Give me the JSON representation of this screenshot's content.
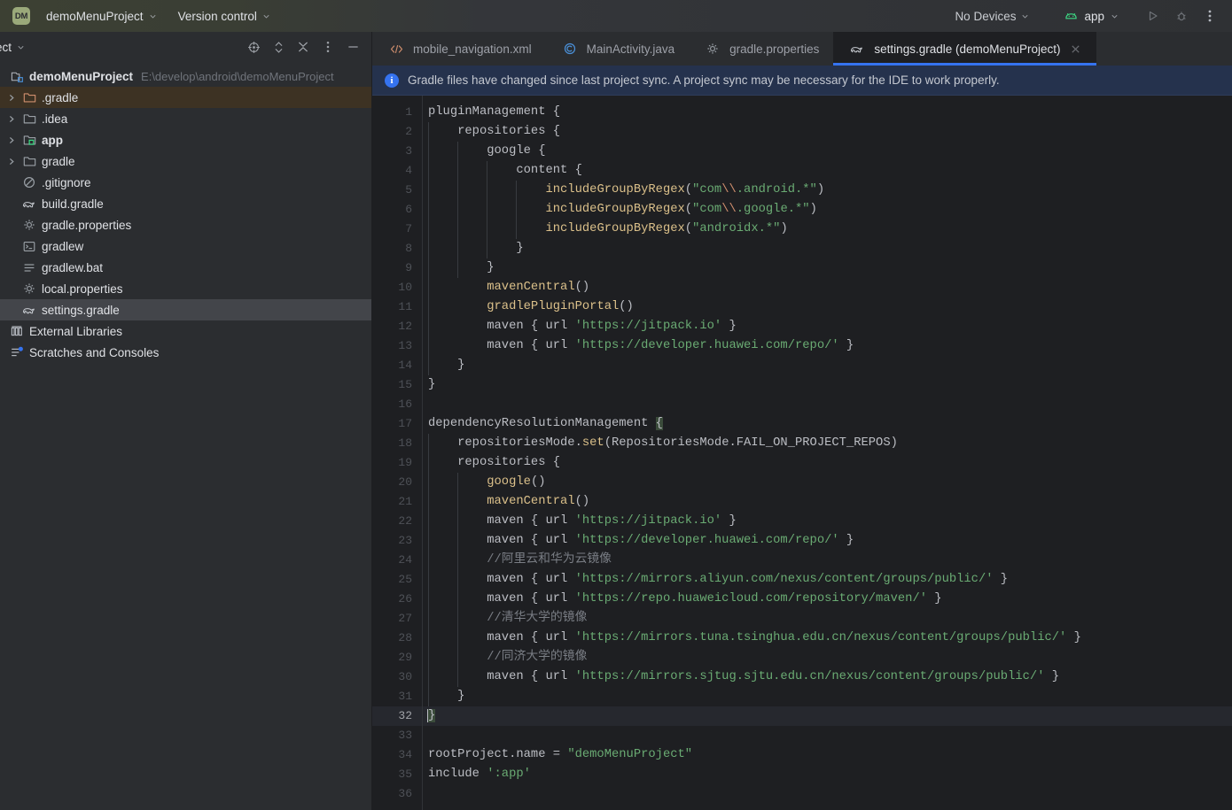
{
  "titlebar": {
    "project_badge": "DM",
    "project_name": "demoMenuProject",
    "version_control": "Version control",
    "devices": "No Devices",
    "run_config": "app",
    "run_tooltip": "Run",
    "debug_tooltip": "Debug",
    "more_tooltip": "More Actions",
    "accent_badge_color": "#9aa97a"
  },
  "sidebar": {
    "title": "ject",
    "tools": [
      "select-opened-file-icon",
      "expand-collapse-icon",
      "collapse-all-icon",
      "options-icon",
      "hide-icon"
    ],
    "tree": [
      {
        "label": "demoMenuProject",
        "path": "E:\\develop\\android\\demoMenuProject",
        "icon": "project-icon",
        "arrow": false,
        "bold": true,
        "state": "root"
      },
      {
        "label": ".gradle",
        "path": "",
        "icon": "folder-orange-icon",
        "arrow": true,
        "bold": false,
        "state": "highlighted"
      },
      {
        "label": ".idea",
        "path": "",
        "icon": "folder-icon",
        "arrow": true,
        "bold": false,
        "state": "normal"
      },
      {
        "label": "app",
        "path": "",
        "icon": "module-icon",
        "arrow": true,
        "bold": true,
        "state": "normal"
      },
      {
        "label": "gradle",
        "path": "",
        "icon": "folder-icon",
        "arrow": true,
        "bold": false,
        "state": "normal"
      },
      {
        "label": ".gitignore",
        "path": "",
        "icon": "gitignore-icon",
        "arrow": false,
        "bold": false,
        "state": "normal"
      },
      {
        "label": "build.gradle",
        "path": "",
        "icon": "gradle-icon",
        "arrow": false,
        "bold": false,
        "state": "normal"
      },
      {
        "label": "gradle.properties",
        "path": "",
        "icon": "properties-icon",
        "arrow": false,
        "bold": false,
        "state": "normal"
      },
      {
        "label": "gradlew",
        "path": "",
        "icon": "shell-icon",
        "arrow": false,
        "bold": false,
        "state": "normal"
      },
      {
        "label": "gradlew.bat",
        "path": "",
        "icon": "text-file-icon",
        "arrow": false,
        "bold": false,
        "state": "normal"
      },
      {
        "label": "local.properties",
        "path": "",
        "icon": "properties-icon",
        "arrow": false,
        "bold": false,
        "state": "normal"
      },
      {
        "label": "settings.gradle",
        "path": "",
        "icon": "gradle-icon",
        "arrow": false,
        "bold": false,
        "state": "selected"
      },
      {
        "label": "External Libraries",
        "path": "",
        "icon": "libraries-icon",
        "arrow": false,
        "bold": false,
        "state": "normal"
      },
      {
        "label": "Scratches and Consoles",
        "path": "",
        "icon": "scratches-icon",
        "arrow": false,
        "bold": false,
        "state": "normal"
      }
    ]
  },
  "editor": {
    "tabs": [
      {
        "label": "mobile_navigation.xml",
        "icon": "xml-icon",
        "active": false,
        "closable": false
      },
      {
        "label": "MainActivity.java",
        "icon": "java-class-icon",
        "active": false,
        "closable": false
      },
      {
        "label": "gradle.properties",
        "icon": "properties-icon",
        "active": false,
        "closable": false
      },
      {
        "label": "settings.gradle (demoMenuProject)",
        "icon": "gradle-icon",
        "active": true,
        "closable": true
      }
    ],
    "banner": {
      "icon": "info-icon",
      "text": "Gradle files have changed since last project sync. A project sync may be necessary for the IDE to work properly."
    },
    "current_line": 32,
    "total_lines": 36,
    "lines": [
      {
        "n": 1,
        "tokens": [
          {
            "t": "def",
            "v": "pluginManagement "
          },
          {
            "t": "brace",
            "v": "{"
          }
        ]
      },
      {
        "n": 2,
        "tokens": [
          {
            "t": "def",
            "v": "    repositories "
          },
          {
            "t": "brace",
            "v": "{"
          }
        ]
      },
      {
        "n": 3,
        "tokens": [
          {
            "t": "def",
            "v": "        google "
          },
          {
            "t": "brace",
            "v": "{"
          }
        ]
      },
      {
        "n": 4,
        "tokens": [
          {
            "t": "def",
            "v": "            content "
          },
          {
            "t": "brace",
            "v": "{"
          }
        ]
      },
      {
        "n": 5,
        "tokens": [
          {
            "t": "def",
            "v": "                "
          },
          {
            "t": "fn",
            "v": "includeGroupByRegex"
          },
          {
            "t": "def",
            "v": "("
          },
          {
            "t": "str",
            "v": "\"com"
          },
          {
            "t": "esc",
            "v": "\\\\"
          },
          {
            "t": "str",
            "v": ".android.*\""
          },
          {
            "t": "def",
            "v": ")"
          }
        ]
      },
      {
        "n": 6,
        "tokens": [
          {
            "t": "def",
            "v": "                "
          },
          {
            "t": "fn",
            "v": "includeGroupByRegex"
          },
          {
            "t": "def",
            "v": "("
          },
          {
            "t": "str",
            "v": "\"com"
          },
          {
            "t": "esc",
            "v": "\\\\"
          },
          {
            "t": "str",
            "v": ".google.*\""
          },
          {
            "t": "def",
            "v": ")"
          }
        ]
      },
      {
        "n": 7,
        "tokens": [
          {
            "t": "def",
            "v": "                "
          },
          {
            "t": "fn",
            "v": "includeGroupByRegex"
          },
          {
            "t": "def",
            "v": "("
          },
          {
            "t": "str",
            "v": "\"androidx.*\""
          },
          {
            "t": "def",
            "v": ")"
          }
        ]
      },
      {
        "n": 8,
        "tokens": [
          {
            "t": "def",
            "v": "            "
          },
          {
            "t": "brace",
            "v": "}"
          }
        ]
      },
      {
        "n": 9,
        "tokens": [
          {
            "t": "def",
            "v": "        "
          },
          {
            "t": "brace",
            "v": "}"
          }
        ]
      },
      {
        "n": 10,
        "tokens": [
          {
            "t": "def",
            "v": "        "
          },
          {
            "t": "fn",
            "v": "mavenCentral"
          },
          {
            "t": "def",
            "v": "()"
          }
        ]
      },
      {
        "n": 11,
        "tokens": [
          {
            "t": "def",
            "v": "        "
          },
          {
            "t": "fn",
            "v": "gradlePluginPortal"
          },
          {
            "t": "def",
            "v": "()"
          }
        ]
      },
      {
        "n": 12,
        "tokens": [
          {
            "t": "def",
            "v": "        maven { url "
          },
          {
            "t": "str",
            "v": "'https://jitpack.io'"
          },
          {
            "t": "def",
            "v": " }"
          }
        ]
      },
      {
        "n": 13,
        "tokens": [
          {
            "t": "def",
            "v": "        maven { url "
          },
          {
            "t": "str",
            "v": "'https://developer.huawei.com/repo/'"
          },
          {
            "t": "def",
            "v": " }"
          }
        ]
      },
      {
        "n": 14,
        "tokens": [
          {
            "t": "def",
            "v": "    "
          },
          {
            "t": "brace",
            "v": "}"
          }
        ]
      },
      {
        "n": 15,
        "tokens": [
          {
            "t": "brace",
            "v": "}"
          }
        ]
      },
      {
        "n": 16,
        "tokens": []
      },
      {
        "n": 17,
        "tokens": [
          {
            "t": "def",
            "v": "dependencyResolutionManagement "
          },
          {
            "t": "match",
            "v": "{"
          }
        ]
      },
      {
        "n": 18,
        "tokens": [
          {
            "t": "def",
            "v": "    repositoriesMode."
          },
          {
            "t": "fn",
            "v": "set"
          },
          {
            "t": "def",
            "v": "(RepositoriesMode.FAIL_ON_PROJECT_REPOS)"
          }
        ]
      },
      {
        "n": 19,
        "tokens": [
          {
            "t": "def",
            "v": "    repositories "
          },
          {
            "t": "brace",
            "v": "{"
          }
        ]
      },
      {
        "n": 20,
        "tokens": [
          {
            "t": "def",
            "v": "        "
          },
          {
            "t": "fn",
            "v": "google"
          },
          {
            "t": "def",
            "v": "()"
          }
        ]
      },
      {
        "n": 21,
        "tokens": [
          {
            "t": "def",
            "v": "        "
          },
          {
            "t": "fn",
            "v": "mavenCentral"
          },
          {
            "t": "def",
            "v": "()"
          }
        ]
      },
      {
        "n": 22,
        "tokens": [
          {
            "t": "def",
            "v": "        maven { url "
          },
          {
            "t": "str",
            "v": "'https://jitpack.io'"
          },
          {
            "t": "def",
            "v": " }"
          }
        ]
      },
      {
        "n": 23,
        "tokens": [
          {
            "t": "def",
            "v": "        maven { url "
          },
          {
            "t": "str",
            "v": "'https://developer.huawei.com/repo/'"
          },
          {
            "t": "def",
            "v": " }"
          }
        ]
      },
      {
        "n": 24,
        "tokens": [
          {
            "t": "cmt",
            "v": "        //阿里云和华为云镜像"
          }
        ]
      },
      {
        "n": 25,
        "tokens": [
          {
            "t": "def",
            "v": "        maven { url "
          },
          {
            "t": "str",
            "v": "'https://mirrors.aliyun.com/nexus/content/groups/public/'"
          },
          {
            "t": "def",
            "v": " }"
          }
        ]
      },
      {
        "n": 26,
        "tokens": [
          {
            "t": "def",
            "v": "        maven { url "
          },
          {
            "t": "str",
            "v": "'https://repo.huaweicloud.com/repository/maven/'"
          },
          {
            "t": "def",
            "v": " }"
          }
        ]
      },
      {
        "n": 27,
        "tokens": [
          {
            "t": "cmt",
            "v": "        //清华大学的镜像"
          }
        ]
      },
      {
        "n": 28,
        "tokens": [
          {
            "t": "def",
            "v": "        maven { url "
          },
          {
            "t": "str",
            "v": "'https://mirrors.tuna.tsinghua.edu.cn/nexus/content/groups/public/'"
          },
          {
            "t": "def",
            "v": " }"
          }
        ]
      },
      {
        "n": 29,
        "tokens": [
          {
            "t": "cmt",
            "v": "        //同济大学的镜像"
          }
        ]
      },
      {
        "n": 30,
        "tokens": [
          {
            "t": "def",
            "v": "        maven { url "
          },
          {
            "t": "str",
            "v": "'https://mirrors.sjtug.sjtu.edu.cn/nexus/content/groups/public/'"
          },
          {
            "t": "def",
            "v": " }"
          }
        ]
      },
      {
        "n": 31,
        "tokens": [
          {
            "t": "def",
            "v": "    "
          },
          {
            "t": "brace",
            "v": "}"
          }
        ]
      },
      {
        "n": 32,
        "tokens": [
          {
            "t": "match",
            "v": "}"
          }
        ]
      },
      {
        "n": 33,
        "tokens": []
      },
      {
        "n": 34,
        "tokens": [
          {
            "t": "def",
            "v": "rootProject.name = "
          },
          {
            "t": "str",
            "v": "\"demoMenuProject\""
          }
        ]
      },
      {
        "n": 35,
        "tokens": [
          {
            "t": "def",
            "v": "include "
          },
          {
            "t": "str",
            "v": "':app'"
          }
        ]
      },
      {
        "n": 36,
        "tokens": []
      }
    ]
  },
  "colors": {
    "accent_blue": "#3573f0",
    "string_green": "#6aab73",
    "function_yellow": "#dbc08a",
    "comment_gray": "#7a7e85",
    "banner_bg": "#25324d",
    "editor_bg": "#1e1f22",
    "panel_bg": "#2b2d30"
  }
}
